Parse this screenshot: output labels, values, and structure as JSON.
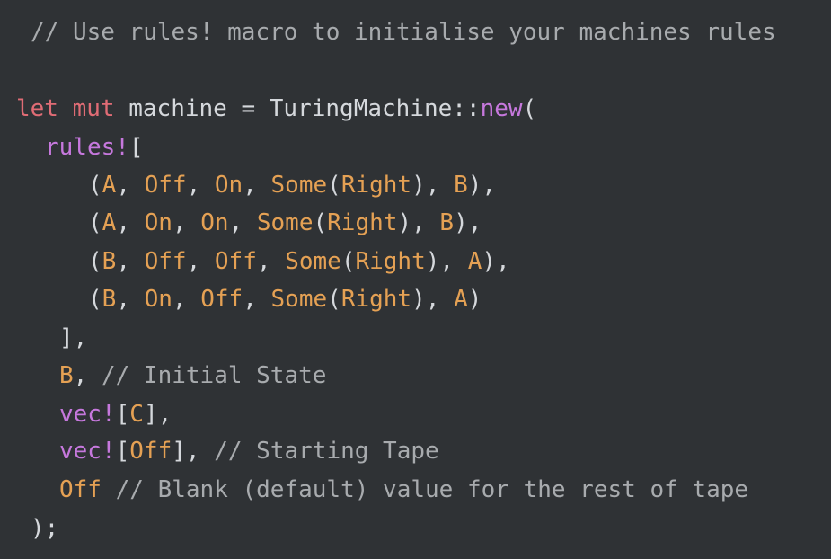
{
  "editor": {
    "lines": [
      {
        "name": "line-1",
        "tokens": [
          {
            "t": "// Use rules! macro to initialise your machines rules",
            "k": "comment"
          }
        ]
      },
      {
        "name": "line-3",
        "tokens": [
          {
            "t": "let",
            "k": "kw"
          },
          {
            "t": " ",
            "k": "plain"
          },
          {
            "t": "mut",
            "k": "kw"
          },
          {
            "t": " machine = TuringMachine::",
            "k": "plain"
          },
          {
            "t": "new",
            "k": "fn"
          },
          {
            "t": "(",
            "k": "punc"
          }
        ]
      },
      {
        "name": "line-4",
        "tokens": [
          {
            "t": "rules!",
            "k": "fn"
          },
          {
            "t": "[",
            "k": "punc"
          }
        ]
      },
      {
        "name": "line-5",
        "tokens": [
          {
            "t": "(",
            "k": "punc"
          },
          {
            "t": "A",
            "k": "const"
          },
          {
            "t": ", ",
            "k": "punc"
          },
          {
            "t": "Off",
            "k": "const"
          },
          {
            "t": ", ",
            "k": "punc"
          },
          {
            "t": "On",
            "k": "const"
          },
          {
            "t": ", ",
            "k": "punc"
          },
          {
            "t": "Some",
            "k": "const"
          },
          {
            "t": "(",
            "k": "punc"
          },
          {
            "t": "Right",
            "k": "const"
          },
          {
            "t": "), ",
            "k": "punc"
          },
          {
            "t": "B",
            "k": "const"
          },
          {
            "t": "),",
            "k": "punc"
          }
        ]
      },
      {
        "name": "line-6",
        "tokens": [
          {
            "t": "(",
            "k": "punc"
          },
          {
            "t": "A",
            "k": "const"
          },
          {
            "t": ", ",
            "k": "punc"
          },
          {
            "t": "On",
            "k": "const"
          },
          {
            "t": ", ",
            "k": "punc"
          },
          {
            "t": "On",
            "k": "const"
          },
          {
            "t": ", ",
            "k": "punc"
          },
          {
            "t": "Some",
            "k": "const"
          },
          {
            "t": "(",
            "k": "punc"
          },
          {
            "t": "Right",
            "k": "const"
          },
          {
            "t": "), ",
            "k": "punc"
          },
          {
            "t": "B",
            "k": "const"
          },
          {
            "t": "),",
            "k": "punc"
          }
        ]
      },
      {
        "name": "line-7",
        "tokens": [
          {
            "t": "(",
            "k": "punc"
          },
          {
            "t": "B",
            "k": "const"
          },
          {
            "t": ", ",
            "k": "punc"
          },
          {
            "t": "Off",
            "k": "const"
          },
          {
            "t": ", ",
            "k": "punc"
          },
          {
            "t": "Off",
            "k": "const"
          },
          {
            "t": ", ",
            "k": "punc"
          },
          {
            "t": "Some",
            "k": "const"
          },
          {
            "t": "(",
            "k": "punc"
          },
          {
            "t": "Right",
            "k": "const"
          },
          {
            "t": "), ",
            "k": "punc"
          },
          {
            "t": "A",
            "k": "const"
          },
          {
            "t": "),",
            "k": "punc"
          }
        ]
      },
      {
        "name": "line-8",
        "tokens": [
          {
            "t": "(",
            "k": "punc"
          },
          {
            "t": "B",
            "k": "const"
          },
          {
            "t": ", ",
            "k": "punc"
          },
          {
            "t": "On",
            "k": "const"
          },
          {
            "t": ", ",
            "k": "punc"
          },
          {
            "t": "Off",
            "k": "const"
          },
          {
            "t": ", ",
            "k": "punc"
          },
          {
            "t": "Some",
            "k": "const"
          },
          {
            "t": "(",
            "k": "punc"
          },
          {
            "t": "Right",
            "k": "const"
          },
          {
            "t": "), ",
            "k": "punc"
          },
          {
            "t": "A",
            "k": "const"
          },
          {
            "t": ")",
            "k": "punc"
          }
        ]
      },
      {
        "name": "line-9",
        "tokens": [
          {
            "t": "],",
            "k": "punc"
          }
        ]
      },
      {
        "name": "line-10",
        "tokens": [
          {
            "t": "B",
            "k": "const"
          },
          {
            "t": ", ",
            "k": "punc"
          },
          {
            "t": "// Initial State",
            "k": "comment"
          }
        ]
      },
      {
        "name": "line-11",
        "tokens": [
          {
            "t": "vec!",
            "k": "fn"
          },
          {
            "t": "[",
            "k": "punc"
          },
          {
            "t": "C",
            "k": "const"
          },
          {
            "t": "],",
            "k": "punc"
          }
        ]
      },
      {
        "name": "line-12",
        "tokens": [
          {
            "t": "vec!",
            "k": "fn"
          },
          {
            "t": "[",
            "k": "punc"
          },
          {
            "t": "Off",
            "k": "const"
          },
          {
            "t": "], ",
            "k": "punc"
          },
          {
            "t": "// Starting Tape",
            "k": "comment"
          }
        ]
      },
      {
        "name": "line-13",
        "tokens": [
          {
            "t": "Off",
            "k": "const"
          },
          {
            "t": " ",
            "k": "plain"
          },
          {
            "t": "// Blank (default) value for the rest of tape",
            "k": "comment"
          }
        ]
      },
      {
        "name": "line-14",
        "tokens": [
          {
            "t": ");",
            "k": "punc"
          }
        ]
      }
    ]
  },
  "colors": {
    "background": "#2f3235",
    "comment": "#a8abae",
    "keyword": "#e06c75",
    "function": "#c678dd",
    "constant": "#e5a154",
    "text": "#d5d8dc"
  }
}
